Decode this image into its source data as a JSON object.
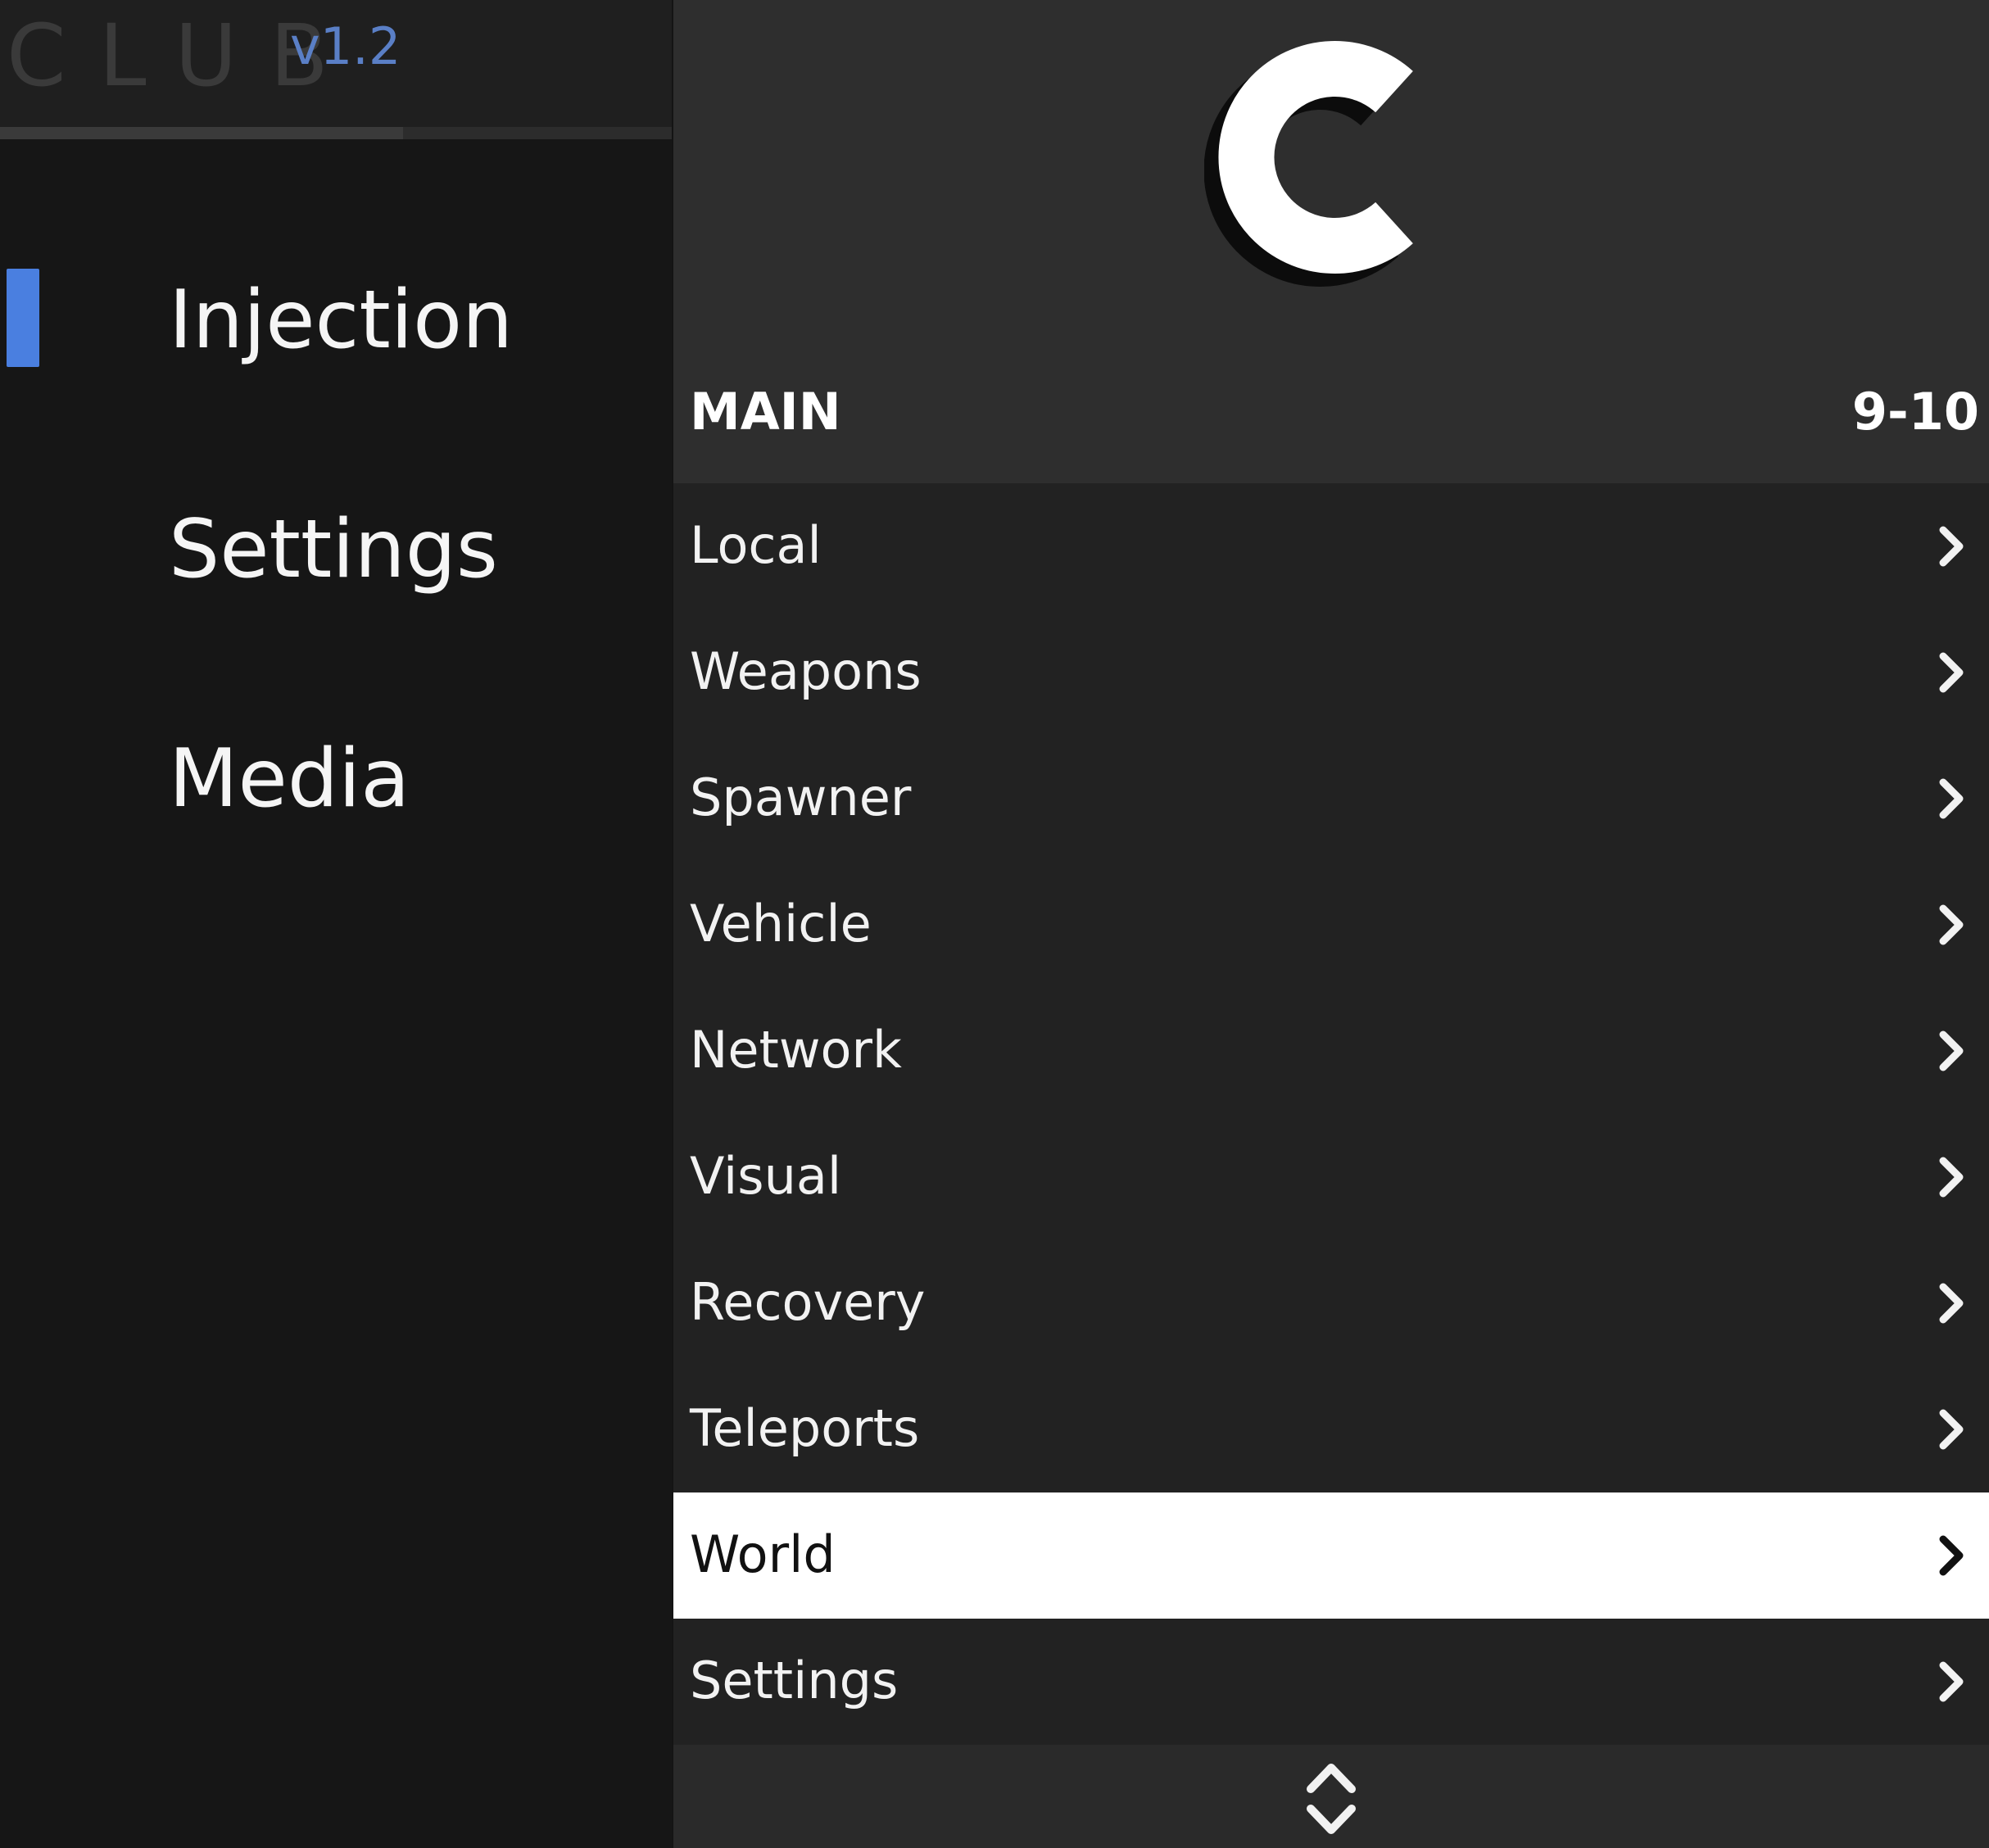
{
  "app": {
    "brand_name": "CLUB",
    "version": "v1.2",
    "accent_color": "#4a7fe0",
    "version_color": "#5a7fc6"
  },
  "sidebar": {
    "active_index": 0,
    "items": [
      {
        "label": "Injection",
        "active": true
      },
      {
        "label": "Settings",
        "active": false
      },
      {
        "label": "Media",
        "active": false
      }
    ]
  },
  "menu": {
    "logo_icon": "c-logo-icon",
    "section_title": "MAIN",
    "page_counter": "9-10",
    "selected_index": 8,
    "items": [
      {
        "label": "Local",
        "icon": "chevron-right-icon"
      },
      {
        "label": "Weapons",
        "icon": "chevron-right-icon"
      },
      {
        "label": "Spawner",
        "icon": "chevron-right-icon"
      },
      {
        "label": "Vehicle",
        "icon": "chevron-right-icon"
      },
      {
        "label": "Network",
        "icon": "chevron-right-icon"
      },
      {
        "label": "Visual",
        "icon": "chevron-right-icon"
      },
      {
        "label": "Recovery",
        "icon": "chevron-right-icon"
      },
      {
        "label": "Teleports",
        "icon": "chevron-right-icon"
      },
      {
        "label": "World",
        "icon": "chevron-right-icon"
      },
      {
        "label": "Settings",
        "icon": "chevron-right-icon"
      }
    ],
    "footer_icon": "scroll-up-down-icon"
  }
}
